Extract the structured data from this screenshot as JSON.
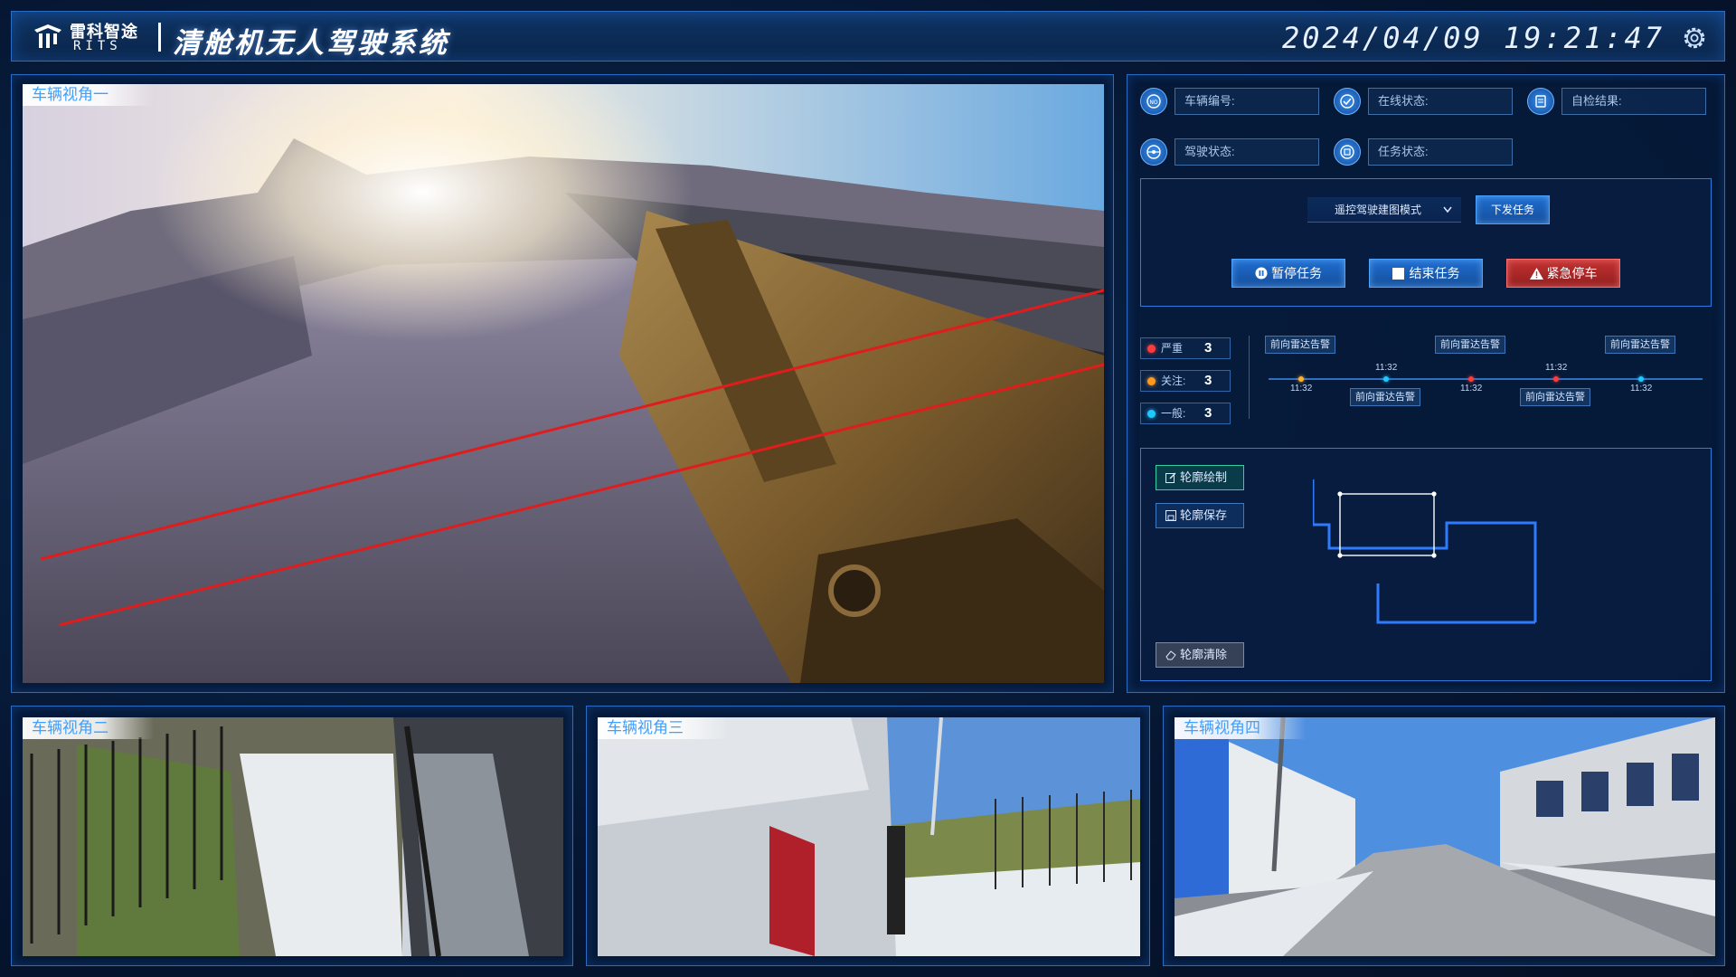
{
  "header": {
    "logo_cn": "雷科智途",
    "logo_en": "RITS",
    "title": "清舱机无人驾驶系统",
    "datetime": "2024/04/09 19:21:47",
    "settings_icon": "gear-icon"
  },
  "cameras": {
    "main_label": "车辆视角一",
    "cam2_label": "车辆视角二",
    "cam3_label": "车辆视角三",
    "cam4_label": "车辆视角四"
  },
  "vehicle_info": {
    "vehicle_id_label": "车辆编号:",
    "online_status_label": "在线状态:",
    "self_check_label": "自检结果:",
    "drive_status_label": "驾驶状态:",
    "task_status_label": "任务状态:"
  },
  "controls": {
    "mode_selected": "遥控驾驶建图模式",
    "dispatch_task": "下发任务",
    "pause_task": "暂停任务",
    "end_task": "结束任务",
    "emergency_stop": "紧急停车"
  },
  "alarm_levels": [
    {
      "label": "严重",
      "count": "3",
      "color": "#ff3b3b"
    },
    {
      "label": "关注:",
      "count": "3",
      "color": "#ff9a1f"
    },
    {
      "label": "一般:",
      "count": "3",
      "color": "#21c8ff"
    }
  ],
  "timeline": [
    {
      "text": "前向雷达告警",
      "time": "11:32",
      "dot": "#ffb02e"
    },
    {
      "text": "前向雷达告警",
      "time": "11:32",
      "dot": "#21c8ff"
    },
    {
      "text": "前向雷达告警",
      "time": "11:32",
      "dot": "#ff3b3b"
    },
    {
      "text": "前向雷达告警",
      "time": "11:32",
      "dot": "#ff3b3b"
    },
    {
      "text": "前向雷达告警",
      "time": "11:32",
      "dot": "#21c8ff"
    }
  ],
  "contour": {
    "draw": "轮廓绘制",
    "save": "轮廓保存",
    "clear": "轮廓清除"
  },
  "colors": {
    "accent": "#2a6cc4",
    "danger": "#c43232",
    "label_blue": "#3fa0ff"
  }
}
